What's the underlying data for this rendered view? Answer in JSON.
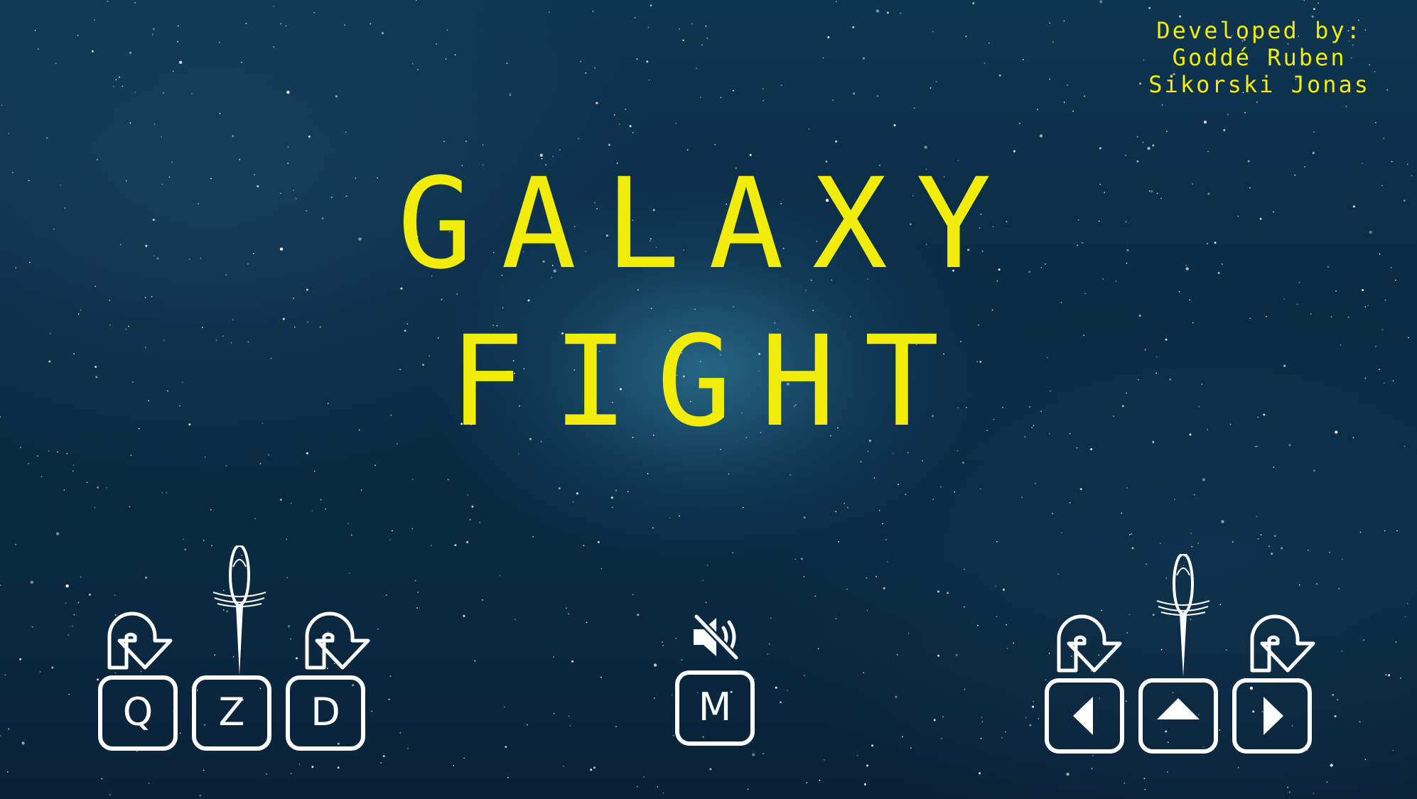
{
  "game": {
    "title_line1": "GALAXY",
    "title_line2": "FIGHT",
    "title_color": "#f2ec0b"
  },
  "credits": {
    "heading": "Developed by:",
    "developers": [
      "Goddé Ruben",
      "Sikorski Jonas"
    ]
  },
  "controls": {
    "player1": {
      "keys": [
        "Q",
        "Z",
        "D"
      ],
      "actions": [
        "rotate-left",
        "thrust",
        "rotate-right"
      ]
    },
    "sound": {
      "key": "M",
      "icon": "speaker-muted-icon"
    },
    "player2": {
      "keys": [
        "left-arrow",
        "up-arrow",
        "right-arrow"
      ],
      "actions": [
        "rotate-left",
        "thrust",
        "rotate-right"
      ]
    }
  },
  "colors": {
    "background": "#0b2b43",
    "accent": "#f2ec0b",
    "controls": "#ffffff"
  }
}
